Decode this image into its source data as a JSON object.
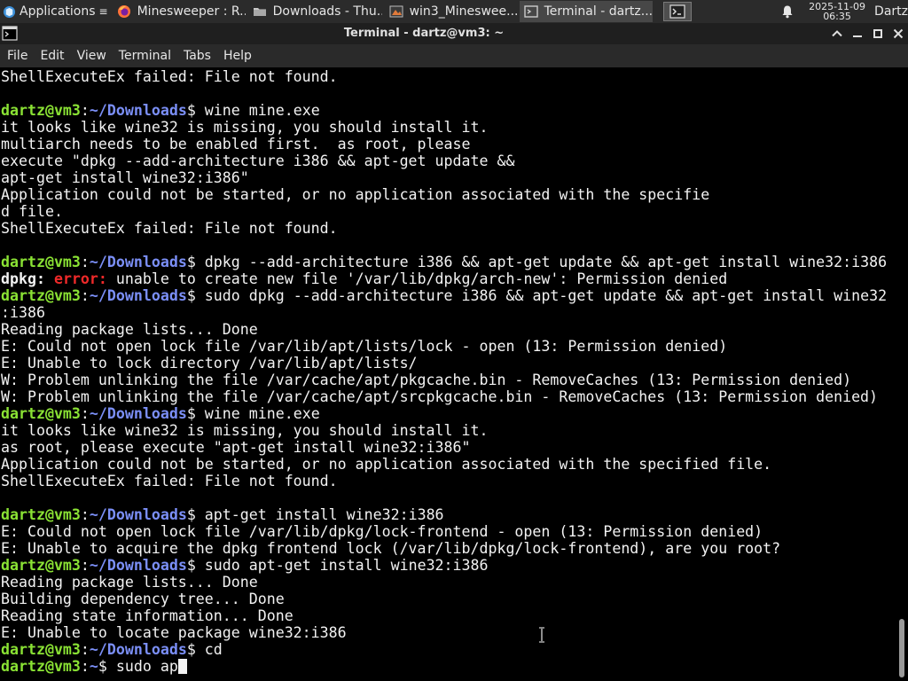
{
  "panel": {
    "applications_label": "Applications",
    "tasks": [
      {
        "label": "Minesweeper : R...",
        "icon": "firefox-icon",
        "active": false
      },
      {
        "label": "Downloads - Thu...",
        "icon": "folder-icon",
        "active": false
      },
      {
        "label": "win3_Minesweе....",
        "icon": "image-icon",
        "active": false
      },
      {
        "label": "Terminal - dartz...",
        "icon": "terminal-icon",
        "active": true
      }
    ],
    "clock_date": "2025-11-09",
    "clock_time": "06:35",
    "user": "Dartz"
  },
  "window": {
    "title": "Terminal - dartz@vm3: ~"
  },
  "menu": {
    "items": [
      "File",
      "Edit",
      "View",
      "Terminal",
      "Tabs",
      "Help"
    ]
  },
  "terminal": {
    "lines": [
      [
        {
          "t": "ShellExecuteEx failed: File not found."
        }
      ],
      [],
      [
        {
          "t": "dartz@vm3",
          "c": "u"
        },
        {
          "t": ":"
        },
        {
          "t": "~/Downloads",
          "c": "p"
        },
        {
          "t": "$ wine mine.exe"
        }
      ],
      [
        {
          "t": "it looks like wine32 is missing, you should install it."
        }
      ],
      [
        {
          "t": "multiarch needs to be enabled first.  as root, please"
        }
      ],
      [
        {
          "t": "execute \"dpkg --add-architecture i386 && apt-get update &&"
        }
      ],
      [
        {
          "t": "apt-get install wine32:i386\""
        }
      ],
      [
        {
          "t": "Application could not be started, or no application associated with the specifie"
        }
      ],
      [
        {
          "t": "d file."
        }
      ],
      [
        {
          "t": "ShellExecuteEx failed: File not found."
        }
      ],
      [],
      [
        {
          "t": "dartz@vm3",
          "c": "u"
        },
        {
          "t": ":"
        },
        {
          "t": "~/Downloads",
          "c": "p"
        },
        {
          "t": "$ dpkg --add-architecture i386 && apt-get update && apt-get install wine32:i386"
        }
      ],
      [
        {
          "t": "dpkg:",
          "c": "w"
        },
        {
          "t": " "
        },
        {
          "t": "error:",
          "c": "e"
        },
        {
          "t": " unable to create new file '/var/lib/dpkg/arch-new': Permission denied"
        }
      ],
      [
        {
          "t": "dartz@vm3",
          "c": "u"
        },
        {
          "t": ":"
        },
        {
          "t": "~/Downloads",
          "c": "p"
        },
        {
          "t": "$ sudo dpkg --add-architecture i386 && apt-get update && apt-get install wine32"
        }
      ],
      [
        {
          "t": ":i386"
        }
      ],
      [
        {
          "t": "Reading package lists... Done"
        }
      ],
      [
        {
          "t": "E: Could not open lock file /var/lib/apt/lists/lock - open (13: Permission denied)"
        }
      ],
      [
        {
          "t": "E: Unable to lock directory /var/lib/apt/lists/"
        }
      ],
      [
        {
          "t": "W: Problem unlinking the file /var/cache/apt/pkgcache.bin - RemoveCaches (13: Permission denied)"
        }
      ],
      [
        {
          "t": "W: Problem unlinking the file /var/cache/apt/srcpkgcache.bin - RemoveCaches (13: Permission denied)"
        }
      ],
      [
        {
          "t": "dartz@vm3",
          "c": "u"
        },
        {
          "t": ":"
        },
        {
          "t": "~/Downloads",
          "c": "p"
        },
        {
          "t": "$ wine mine.exe"
        }
      ],
      [
        {
          "t": "it looks like wine32 is missing, you should install it."
        }
      ],
      [
        {
          "t": "as root, please execute \"apt-get install wine32:i386\""
        }
      ],
      [
        {
          "t": "Application could not be started, or no application associated with the specified file."
        }
      ],
      [
        {
          "t": "ShellExecuteEx failed: File not found."
        }
      ],
      [],
      [
        {
          "t": "dartz@vm3",
          "c": "u"
        },
        {
          "t": ":"
        },
        {
          "t": "~/Downloads",
          "c": "p"
        },
        {
          "t": "$ apt-get install wine32:i386"
        }
      ],
      [
        {
          "t": "E: Could not open lock file /var/lib/dpkg/lock-frontend - open (13: Permission denied)"
        }
      ],
      [
        {
          "t": "E: Unable to acquire the dpkg frontend lock (/var/lib/dpkg/lock-frontend), are you root?"
        }
      ],
      [
        {
          "t": "dartz@vm3",
          "c": "u"
        },
        {
          "t": ":"
        },
        {
          "t": "~/Downloads",
          "c": "p"
        },
        {
          "t": "$ sudo apt-get install wine32:i386"
        }
      ],
      [
        {
          "t": "Reading package lists... Done"
        }
      ],
      [
        {
          "t": "Building dependency tree... Done"
        }
      ],
      [
        {
          "t": "Reading state information... Done"
        }
      ],
      [
        {
          "t": "E: Unable to locate package wine32:i386"
        }
      ],
      [
        {
          "t": "dartz@vm3",
          "c": "u"
        },
        {
          "t": ":"
        },
        {
          "t": "~/Downloads",
          "c": "p"
        },
        {
          "t": "$ cd"
        }
      ],
      [
        {
          "t": "dartz@vm3",
          "c": "u"
        },
        {
          "t": ":"
        },
        {
          "t": "~",
          "c": "p"
        },
        {
          "t": "$ sudo ap"
        }
      ]
    ],
    "colors": {
      "user": "#8ae234",
      "path": "#7b8ff7",
      "error": "#ef2929",
      "text": "#f2f2f2",
      "background": "#000000"
    }
  }
}
